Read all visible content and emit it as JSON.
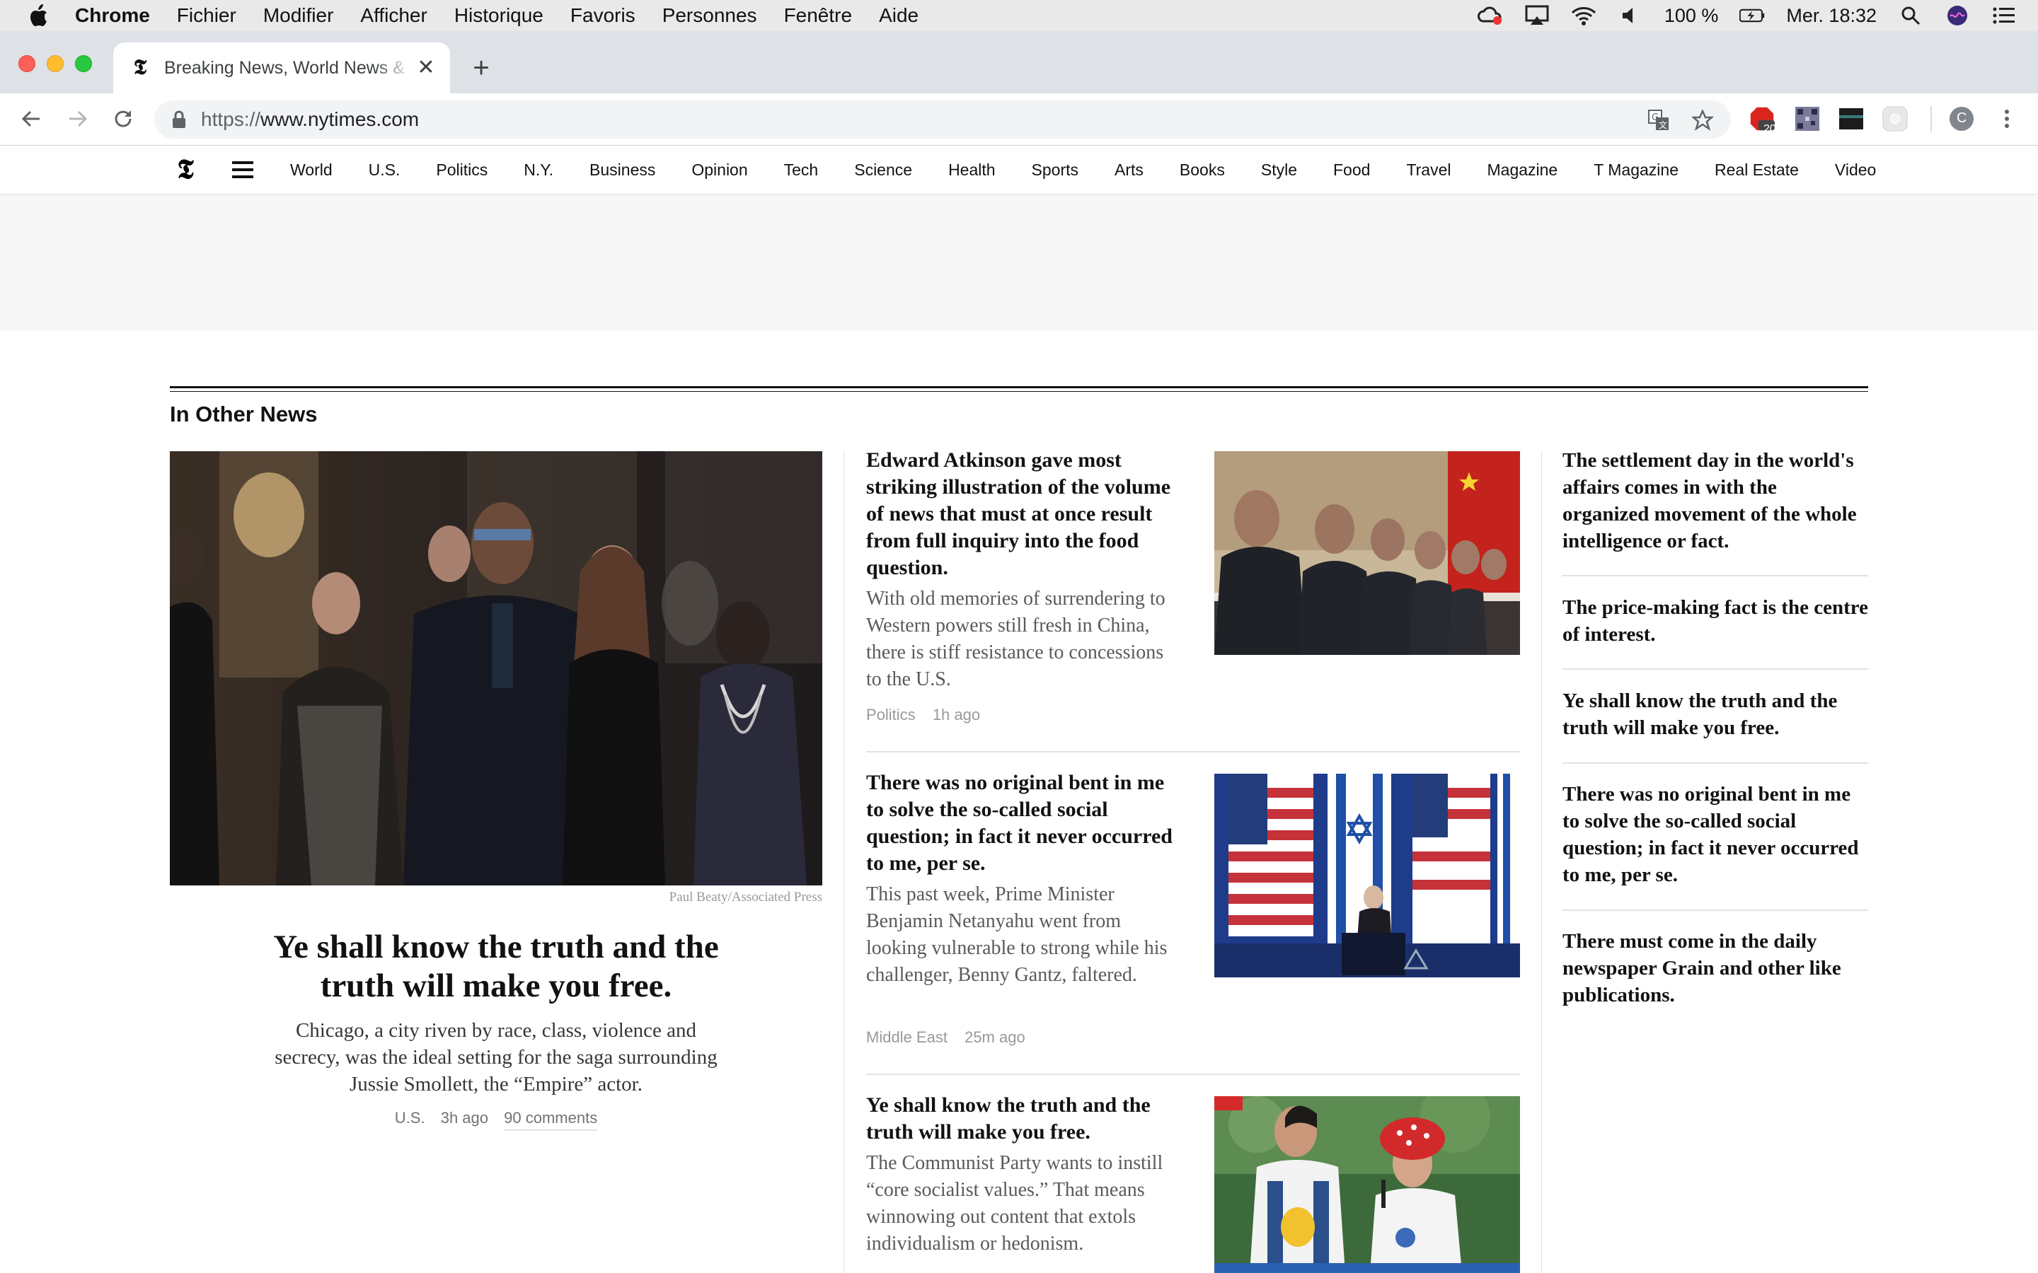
{
  "os_menubar": {
    "app_name": "Chrome",
    "menus": [
      "Fichier",
      "Modifier",
      "Afficher",
      "Historique",
      "Favoris",
      "Personnes",
      "Fenêtre",
      "Aide"
    ],
    "battery": "100 %",
    "clock": "Mer. 18:32"
  },
  "browser": {
    "tab_title": "Breaking News, World News & Multimedia - The New York Times",
    "url_scheme": "https://",
    "url_host": "www.nytimes.com",
    "extension_badge": "20",
    "profile_initial": "C"
  },
  "site_nav": {
    "sections": [
      "World",
      "U.S.",
      "Politics",
      "N.Y.",
      "Business",
      "Opinion",
      "Tech",
      "Science",
      "Health",
      "Sports",
      "Arts",
      "Books",
      "Style",
      "Food",
      "Travel",
      "Magazine",
      "T Magazine",
      "Real Estate",
      "Video"
    ]
  },
  "package": {
    "label": "In Other News",
    "lead": {
      "credit": "Paul Beaty/Associated Press",
      "headline": "Ye shall know the truth and the truth will make you free.",
      "summary": "Chicago, a city riven by race, class, violence and secrecy, was the ideal setting for the saga surrounding Jussie Smollett, the “Empire” actor.",
      "section": "U.S.",
      "time": "3h ago",
      "comments": "90 comments"
    },
    "stories": [
      {
        "headline": "Edward Atkinson gave most striking illustration of the volume of news that must at once result from full inquiry into the food question.",
        "summary": "With old memories of surrendering to Western powers still fresh in China, there is stiff resistance to concessions to the U.S.",
        "section": "Politics",
        "time": "1h ago"
      },
      {
        "headline": "There was no original bent in me to solve the so-called social question; in fact it never occurred to me, per se.",
        "summary": "This past week, Prime Minister Benjamin Netanyahu went from looking vulnerable to strong while his challenger, Benny Gantz, faltered.",
        "section": "Middle East",
        "time": "25m ago"
      },
      {
        "headline": "Ye shall know the truth and the truth will make you free.",
        "summary": "The Communist Party wants to instill “core socialist values.” That means winnowing out content that extols individualism or hedonism.",
        "section": "",
        "time": ""
      }
    ],
    "right_column": [
      "The settlement day in the world's affairs comes in with the organized movement of the whole intelligence or fact.",
      "The price-making fact is the centre of interest.",
      "Ye shall know the truth and the truth will make you free.",
      "There was no original bent in me to solve the so-called social question; in fact it never occurred to me, per se.",
      "There must come in the daily newspaper Grain and other like publications."
    ]
  }
}
